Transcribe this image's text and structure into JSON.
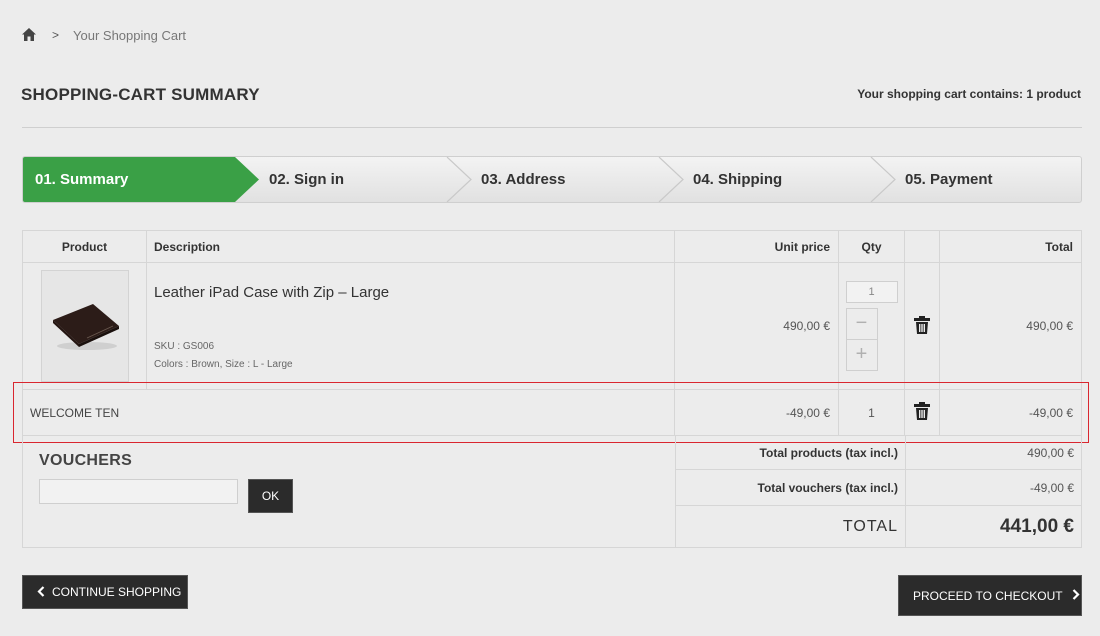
{
  "breadcrumb": {
    "home_icon": "home-icon",
    "separator": ">",
    "current": "Your Shopping Cart"
  },
  "page": {
    "title": "SHOPPING-CART SUMMARY",
    "cart_count": "Your shopping cart contains: 1 product"
  },
  "steps": [
    {
      "label": "01. Summary",
      "active": true
    },
    {
      "label": "02. Sign in",
      "active": false
    },
    {
      "label": "03. Address",
      "active": false
    },
    {
      "label": "04. Shipping",
      "active": false
    },
    {
      "label": "05. Payment",
      "active": false
    }
  ],
  "colors": {
    "active_step": "#3aa046",
    "highlight_border": "#d9262f",
    "dark_button": "#2b2b2b"
  },
  "table": {
    "headers": {
      "product": "Product",
      "description": "Description",
      "unit_price": "Unit price",
      "qty": "Qty",
      "total": "Total"
    },
    "product_row": {
      "name": "Leather iPad Case with Zip – Large",
      "sku": "SKU : GS006",
      "attributes": "Colors : Brown, Size : L - Large",
      "unit_price": "490,00 €",
      "qty": "1",
      "minus": "−",
      "plus": "+",
      "total": "490,00 €",
      "delete_icon": "trash-icon"
    },
    "voucher_row": {
      "name": "WELCOME TEN",
      "unit_price": "-49,00 €",
      "qty": "1",
      "total": "-49,00 €",
      "delete_icon": "trash-icon"
    }
  },
  "vouchers": {
    "title": "VOUCHERS",
    "input_value": "",
    "ok_label": "OK"
  },
  "totals": {
    "products_label": "Total products (tax incl.)",
    "products_value": "490,00 €",
    "vouchers_label": "Total vouchers (tax incl.)",
    "vouchers_value": "-49,00 €",
    "total_label": "TOTAL",
    "total_value": "441,00 €"
  },
  "buttons": {
    "continue_label": "CONTINUE SHOPPING",
    "continue_icon": "chevron-left-icon",
    "checkout_label": "PROCEED TO CHECKOUT",
    "checkout_icon": "chevron-right-icon"
  }
}
